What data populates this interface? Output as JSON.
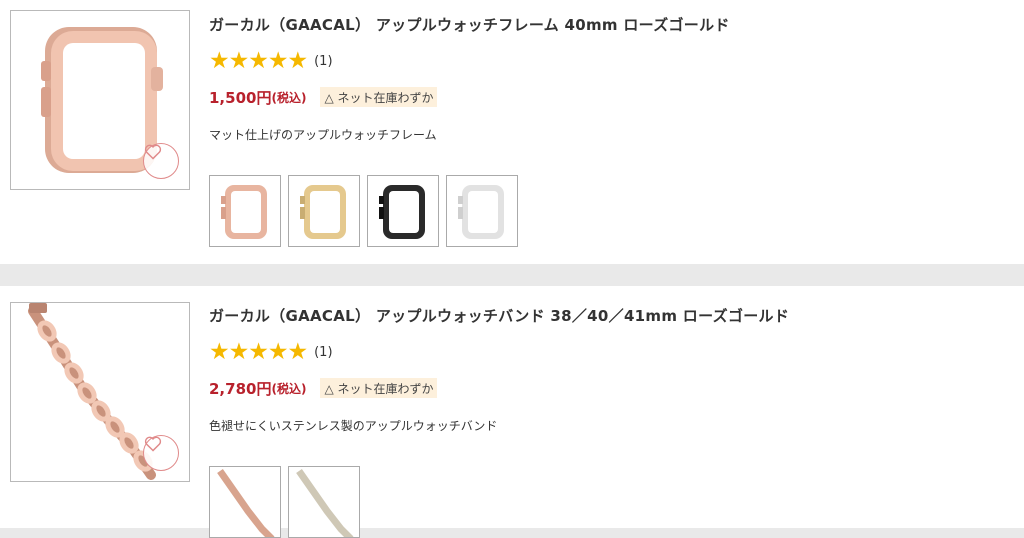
{
  "products": [
    {
      "title": "ガーカル（GAACAL） アップルウォッチフレーム 40mm ローズゴールド",
      "stars": "★★★★★",
      "review_count": "(1)",
      "price": "1,500円",
      "tax_note": "(税込)",
      "stock": "△ ネット在庫わずか",
      "description": "マット仕上げのアップルウォッチフレーム",
      "image_icon": "watch-frame-image",
      "variant_colors": [
        "#e8b5a0",
        "#e5c98e",
        "#2a2a2a",
        "#eeeeee"
      ]
    },
    {
      "title": "ガーカル（GAACAL） アップルウォッチバンド 38／40／41mm ローズゴールド",
      "stars": "★★★★★",
      "review_count": "(1)",
      "price": "2,780円",
      "tax_note": "(税込)",
      "stock": "△ ネット在庫わずか",
      "description": "色褪せにくいステンレス製のアップルウォッチバンド",
      "image_icon": "watch-band-image",
      "variant_colors": [
        "#d8a48e",
        "#d9d3c4"
      ]
    }
  ],
  "colors": {
    "price": "#b8212c",
    "star": "#f5b800",
    "stock_bg": "#fdf0dc",
    "favorite": "#e08a8a"
  }
}
